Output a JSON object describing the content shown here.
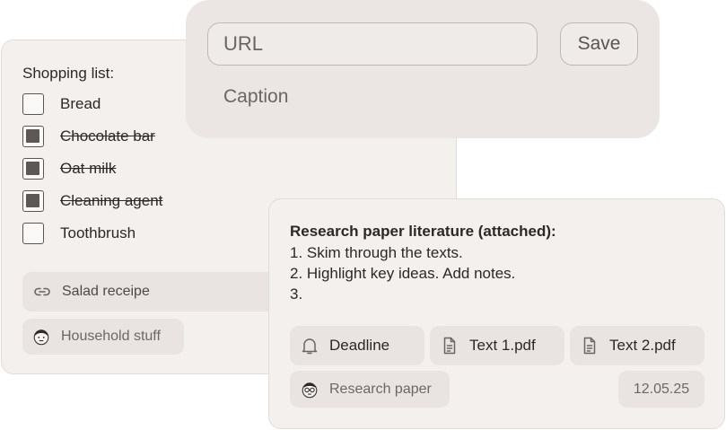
{
  "shopping_list": {
    "title": "Shopping list:",
    "items": [
      {
        "label": "Bread",
        "checked": false
      },
      {
        "label": "Chocolate bar",
        "checked": true
      },
      {
        "label": "Oat milk",
        "checked": true
      },
      {
        "label": "Cleaning agent",
        "checked": true
      },
      {
        "label": "Toothbrush",
        "checked": false
      }
    ],
    "link_chip": {
      "label": "Salad receipe",
      "icon": "link-icon"
    },
    "tag_chip": {
      "label": "Household stuff",
      "icon": "avatar-icon"
    }
  },
  "link_editor": {
    "url_placeholder": "URL",
    "save_label": "Save",
    "caption_label": "Caption"
  },
  "research_note": {
    "title": "Research paper literature (attached):",
    "lines": [
      "1. Skim through the texts.",
      "2. Highlight key ideas. Add notes.",
      "3."
    ],
    "chips": [
      {
        "label": "Deadline",
        "icon": "bell-icon"
      },
      {
        "label": "Text 1.pdf",
        "icon": "document-icon"
      },
      {
        "label": "Text 2.pdf",
        "icon": "document-icon"
      }
    ],
    "tag_chip": {
      "label": "Research paper",
      "icon": "avatar-glasses-icon"
    },
    "date": "12.05.25"
  }
}
